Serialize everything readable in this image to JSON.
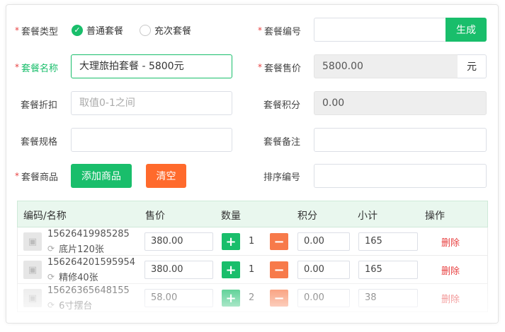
{
  "form": {
    "package_type": {
      "label": "套餐类型",
      "options": [
        {
          "label": "普通套餐",
          "checked": true
        },
        {
          "label": "充次套餐",
          "checked": false
        }
      ]
    },
    "package_code": {
      "label": "套餐编号",
      "value": "",
      "generate_label": "生成"
    },
    "package_name": {
      "label": "套餐名称",
      "value": "大理旅拍套餐 - 5800元"
    },
    "package_price": {
      "label": "套餐售价",
      "value": "5800.00",
      "unit": "元"
    },
    "package_discount": {
      "label": "套餐折扣",
      "placeholder": "取值0-1之间"
    },
    "package_points": {
      "label": "套餐积分",
      "value": "0.00"
    },
    "package_spec": {
      "label": "套餐规格",
      "value": ""
    },
    "package_note": {
      "label": "套餐备注",
      "value": ""
    },
    "package_goods": {
      "label": "套餐商品",
      "add_label": "添加商品",
      "clear_label": "清空"
    },
    "sort_number": {
      "label": "排序编号",
      "value": ""
    },
    "required_mark": "*"
  },
  "table": {
    "headers": [
      "编码/名称",
      "售价",
      "数量",
      "积分",
      "小计",
      "操作"
    ],
    "rows": [
      {
        "code": "15626419985285",
        "name": "底片120张",
        "price": "380.00",
        "qty": "1",
        "points": "0.00",
        "subtotal": "165",
        "action": "删除"
      },
      {
        "code": "15626420159595​4",
        "name": "精修40张",
        "price": "380.00",
        "qty": "1",
        "points": "0.00",
        "subtotal": "165",
        "action": "删除"
      },
      {
        "code": "15626365648155",
        "name": "6寸摆台",
        "price": "58.00",
        "qty": "2",
        "points": "0.00",
        "subtotal": "38",
        "action": "删除"
      }
    ]
  },
  "colors": {
    "primary": "#19be6b",
    "danger": "#e84141",
    "warning": "#ff6a2c"
  }
}
